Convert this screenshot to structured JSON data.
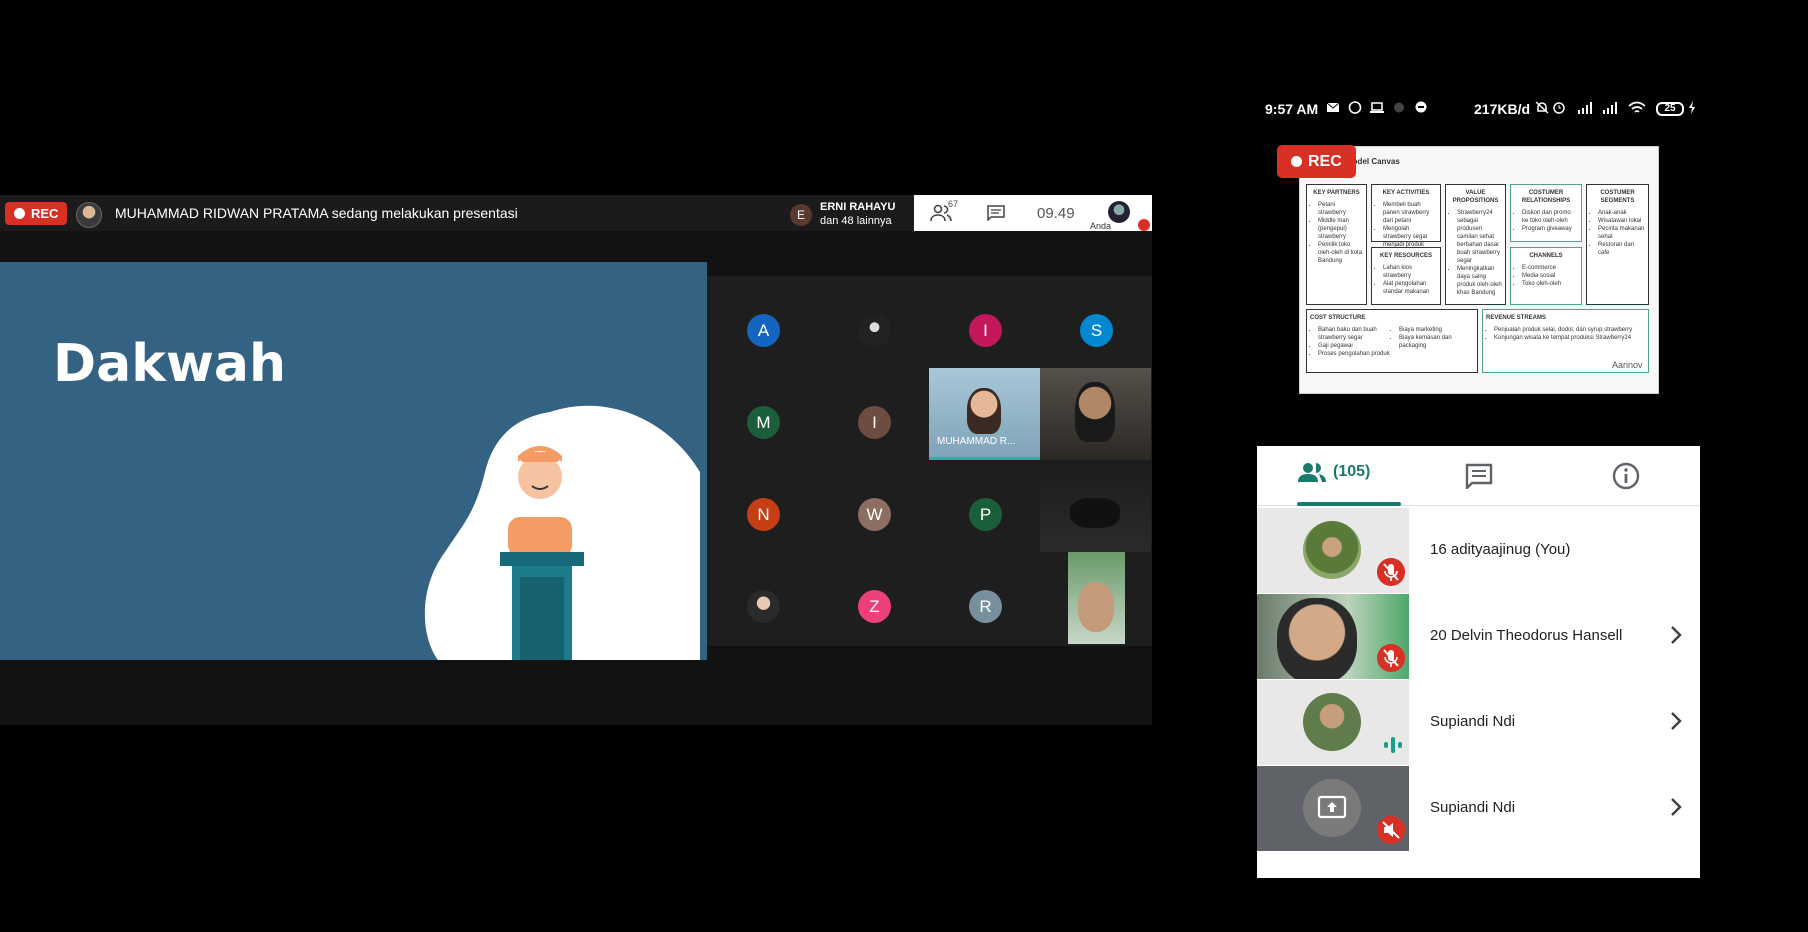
{
  "meet": {
    "rec_label": "REC",
    "presenter_text": "MUHAMMAD RIDWAN PRATAMA sedang melakukan presentasi",
    "raised_hand": {
      "initial": "E",
      "name": "ERNI RAHAYU",
      "more": "dan 48 lainnya"
    },
    "participant_count": "67",
    "clock": "09.49",
    "self_label": "Anda",
    "slide_title": "Dakwah",
    "tiles": [
      {
        "initial": "A",
        "color": "#1565c0"
      },
      {
        "initial": "",
        "color": "#222222"
      },
      {
        "initial": "I",
        "color": "#c2185b"
      },
      {
        "initial": "S",
        "color": "#0288d1"
      },
      {
        "initial": "M",
        "color": "#1b5e3a"
      },
      {
        "initial": "I",
        "color": "#6d4c41"
      },
      {
        "initial": "N",
        "color": "#c53e16"
      },
      {
        "initial": "W",
        "color": "#8d6e63"
      },
      {
        "initial": "P",
        "color": "#1b5e3a"
      },
      {
        "initial": "Z",
        "color": "#ec407a"
      },
      {
        "initial": "R",
        "color": "#78909c"
      }
    ],
    "speaking_tile_label": "MUHAMMAD R..."
  },
  "phone": {
    "status": {
      "time": "9:57 AM",
      "speed": "217KB/d",
      "battery": "25"
    },
    "rec_label": "REC",
    "canvas": {
      "title": "Model Canvas",
      "watermark": "Aarinov",
      "key_partners": {
        "title": "KEY PARTNERS",
        "items": [
          "Petani strawberry",
          "Middle man (pengepul) strawberry",
          "Pemilik toko oleh-oleh di kota Bandung"
        ]
      },
      "key_activities": {
        "title": "KEY ACTIVITIES",
        "items": [
          "Membeli buah panen strawberry dari petani",
          "Mengolah strawberry segar menjadi produk olahan"
        ]
      },
      "key_resources": {
        "title": "KEY RESOURCES",
        "items": [
          "Lahan kios strawberry",
          "Alat pengolahan standar makanan"
        ]
      },
      "value_propositions": {
        "title": "VALUE PROPOSITIONS",
        "items": [
          "Strawberry24 sebagai produsen camilan sehat berbahan dasar buah strawberry segar",
          "Meningkatkan daya saing produk oleh-oleh khas Bandung"
        ]
      },
      "customer_relationships": {
        "title": "COSTUMER RELATIONSHIPS",
        "items": [
          "Diskon dan promo ke toko oleh-oleh",
          "Program giveaway"
        ]
      },
      "channels": {
        "title": "CHANNELS",
        "items": [
          "E-commerce",
          "Media sosial",
          "Toko oleh-oleh"
        ]
      },
      "customer_segments": {
        "title": "COSTUMER SEGMENTS",
        "items": [
          "Anak-anak",
          "Wisatawan lokal",
          "Pecinta makanan sehat",
          "Restoran dan cafe"
        ]
      },
      "cost_structure": {
        "title": "COST STRUCTURE",
        "items": [
          "Bahan baku dari buah strawberry segar",
          "Gaji pegawai",
          "Proses pengolahan produk",
          "Biaya marketing",
          "Biaya kemasan dan packaging"
        ]
      },
      "revenue_streams": {
        "title": "REVENUE STREAMS",
        "items": [
          "Penjualan produk selai, dodol, dan syrup strawberry",
          "Kunjungan wisata ke tempat produksi Strawberry24"
        ]
      }
    },
    "panel": {
      "people_count": "(105)",
      "participants": [
        {
          "name": "16 adityaajinug (You)",
          "state": "muted"
        },
        {
          "name": "20 Delvin Theodorus Hansell",
          "state": "muted"
        },
        {
          "name": "Supiandi Ndi",
          "state": "speaking"
        },
        {
          "name": "Supiandi Ndi",
          "state": "presenting-muted"
        }
      ]
    }
  }
}
